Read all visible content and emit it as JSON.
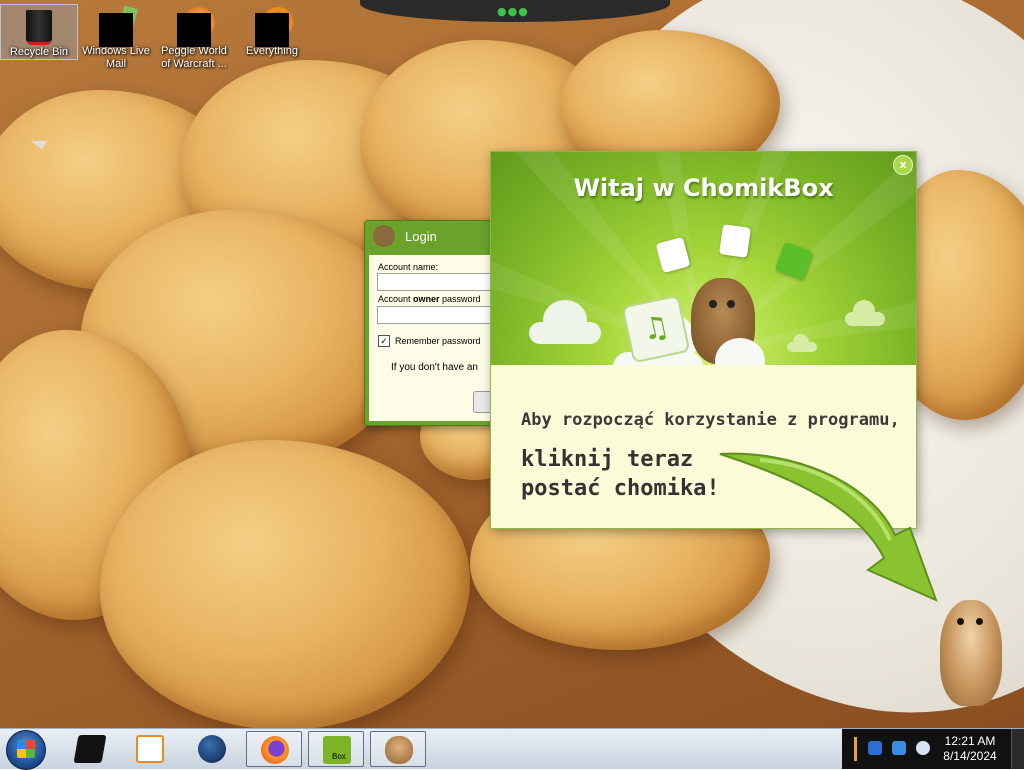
{
  "desktop": {
    "icons": [
      {
        "label": "Recycle Bin",
        "icon": "recycle-bin-icon"
      },
      {
        "label": "Windows Live Mail",
        "icon": "windows-live-mail-icon"
      },
      {
        "label": "Peggle World of Warcraft ...",
        "icon": "peggle-icon"
      },
      {
        "label": "Everything",
        "icon": "everything-icon"
      }
    ]
  },
  "login": {
    "title": "Login",
    "account_name_label": "Account name:",
    "password_label_prefix": "Account ",
    "password_label_bold": "owner",
    "password_label_suffix": " password",
    "remember_label": "Remember password",
    "remember_checked": true,
    "check_mark": "✓",
    "signup_text": "If you don't have an"
  },
  "popup": {
    "title": "Witaj w ChomikBox",
    "close_label": "x",
    "line1": "Aby rozpocząć korzystanie z programu,",
    "line2": "kliknij teraz",
    "line3": "postać chomika!",
    "accent_color": "#7bb426"
  },
  "taskbar": {
    "start_label": "Start",
    "items": [
      {
        "name": "console-icon"
      },
      {
        "name": "media-player-icon"
      },
      {
        "name": "globe-icon"
      },
      {
        "name": "firefox-icon"
      },
      {
        "name": "chomikbox-icon",
        "label": "Box"
      },
      {
        "name": "hamster-icon"
      }
    ],
    "clock": {
      "time": "12:21 AM",
      "date": "8/14/2024"
    }
  }
}
